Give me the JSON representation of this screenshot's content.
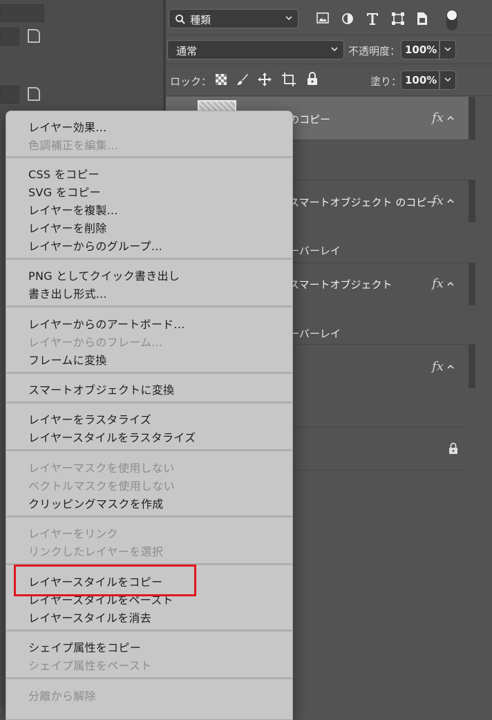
{
  "layers_panel": {
    "filter_label": "種類",
    "blend_mode": "通常",
    "opacity_label": "不透明度：",
    "opacity_value": "100%",
    "lock_label": "ロック：",
    "fill_label": "塗り：",
    "fill_value": "100%",
    "layers": [
      {
        "name": "のコピー",
        "fx": "fx",
        "sub": ""
      },
      {
        "name": "スマートオブジェクト のコピー",
        "fx": "fx",
        "sub": "ーバーレイ"
      },
      {
        "name": "スマートオブジェクト",
        "fx": "fx",
        "sub": "ーバーレイ"
      },
      {
        "name": "",
        "fx": "fx",
        "sub": ""
      }
    ]
  },
  "context_menu": {
    "items": [
      {
        "label": "レイヤー効果...",
        "enabled": true
      },
      {
        "label": "色調補正を編集...",
        "enabled": false
      },
      {
        "label": "CSS をコピー",
        "enabled": true
      },
      {
        "label": "SVG をコピー",
        "enabled": true
      },
      {
        "label": "レイヤーを複製...",
        "enabled": true
      },
      {
        "label": "レイヤーを削除",
        "enabled": true
      },
      {
        "label": "レイヤーからのグループ...",
        "enabled": true
      },
      {
        "label": "PNG としてクイック書き出し",
        "enabled": true
      },
      {
        "label": "書き出し形式...",
        "enabled": true
      },
      {
        "label": "レイヤーからのアートボード...",
        "enabled": true
      },
      {
        "label": "レイヤーからのフレーム...",
        "enabled": false
      },
      {
        "label": "フレームに変換",
        "enabled": true
      },
      {
        "label": "スマートオブジェクトに変換",
        "enabled": true
      },
      {
        "label": "レイヤーをラスタライズ",
        "enabled": true
      },
      {
        "label": "レイヤースタイルをラスタライズ",
        "enabled": true
      },
      {
        "label": "レイヤーマスクを使用しない",
        "enabled": false
      },
      {
        "label": "ベクトルマスクを使用しない",
        "enabled": false
      },
      {
        "label": "クリッピングマスクを作成",
        "enabled": true
      },
      {
        "label": "レイヤーをリンク",
        "enabled": false
      },
      {
        "label": "リンクしたレイヤーを選択",
        "enabled": false
      },
      {
        "label": "レイヤースタイルをコピー",
        "enabled": true
      },
      {
        "label": "レイヤースタイルをペースト",
        "enabled": true
      },
      {
        "label": "レイヤースタイルを消去",
        "enabled": true
      },
      {
        "label": "シェイプ属性をコピー",
        "enabled": true
      },
      {
        "label": "シェイプ属性をペースト",
        "enabled": false
      },
      {
        "label": "分離から解除",
        "enabled": false
      }
    ]
  },
  "colors": {
    "menu_background": "#c7c7c7",
    "panel_background": "#535353",
    "highlight_box": "#e0161b"
  }
}
